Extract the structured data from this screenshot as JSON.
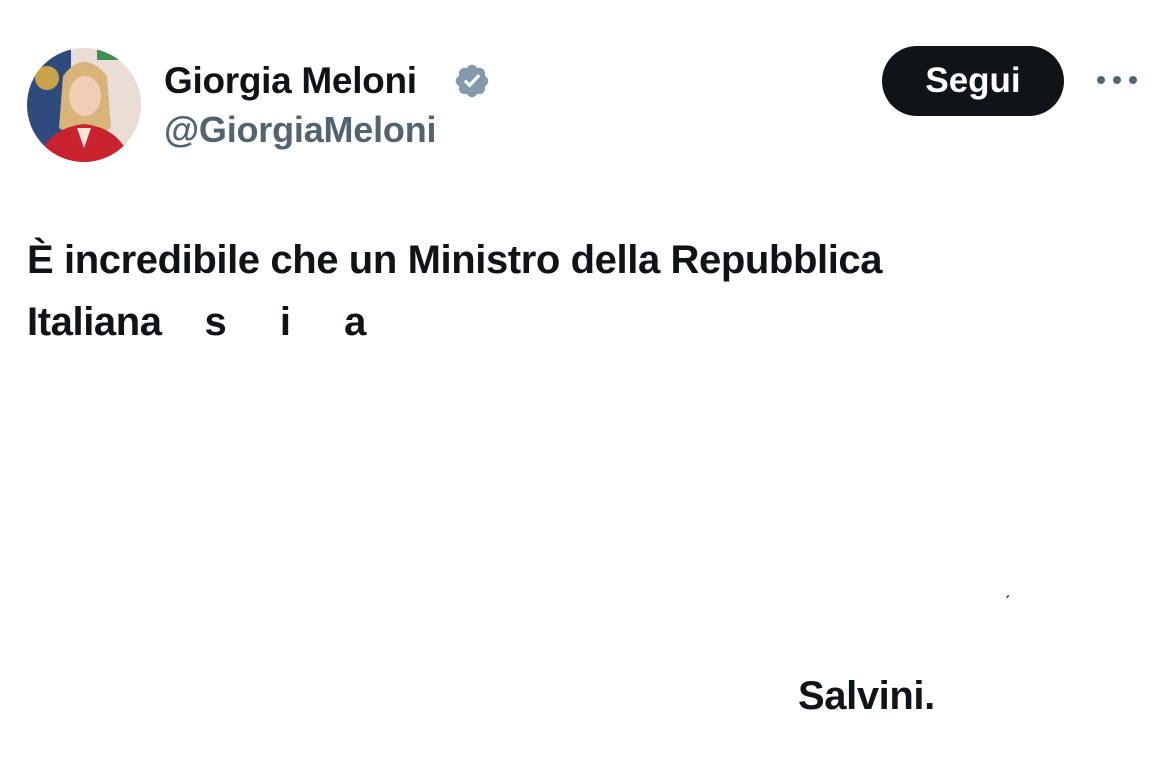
{
  "author": {
    "display_name": "Giorgia Meloni",
    "handle": "@GiorgiaMeloni",
    "verified_icon": "verified-badge-icon",
    "avatar": "profile-photo"
  },
  "actions": {
    "follow_label": "Segui",
    "more_icon": "more-horizontal-icon"
  },
  "tweet": {
    "line_1": "È incredibile che un Ministro della Repubblica",
    "line_2": "Italiana    s     i     a",
    "line_3": "Salvini.",
    "stray_mark": "ˏ"
  },
  "colors": {
    "text_primary": "#0f1419",
    "text_secondary": "#536471",
    "button_bg": "#0f1419",
    "button_text": "#ffffff",
    "verified_badge": "#829aab"
  }
}
